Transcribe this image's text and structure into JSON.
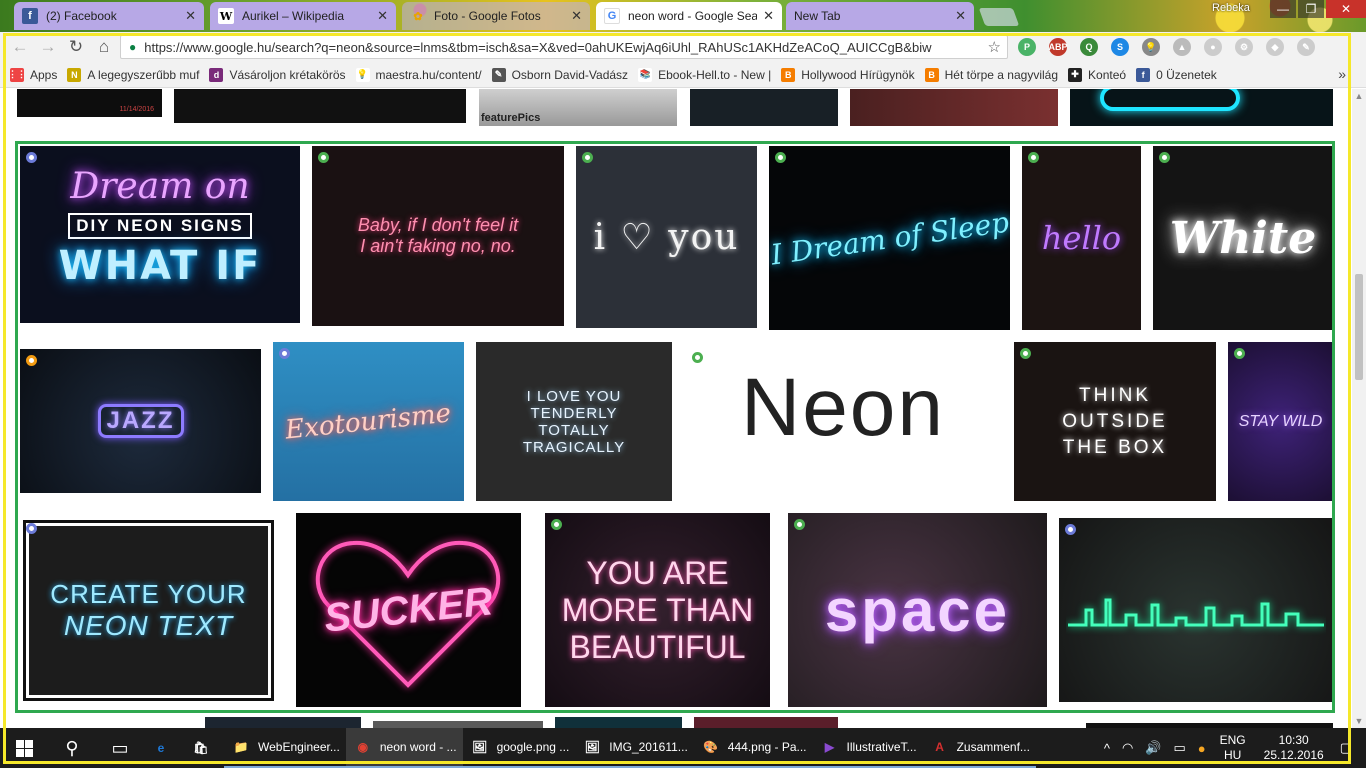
{
  "tabs": [
    {
      "label": "(2) Facebook",
      "fav": "f",
      "favColor": "#3b5998"
    },
    {
      "label": "Aurikel – Wikipedia",
      "fav": "W",
      "favColor": "#fff"
    },
    {
      "label": "Foto - Google Fotos",
      "fav": "✿",
      "favColor": "#e8a400"
    },
    {
      "label": "neon word - Google Sea",
      "fav": "G",
      "favColor": "#fff"
    },
    {
      "label": "New Tab",
      "fav": "",
      "favColor": ""
    }
  ],
  "profile": "Rebeka",
  "window_buttons": {
    "min": "—",
    "max": "❐",
    "close": "✕"
  },
  "toolbar": {
    "back": "←",
    "forward": "→",
    "reload": "↻",
    "home": "⌂",
    "url": "https://www.google.hu/search?q=neon&source=lnms&tbm=isch&sa=X&ved=0ahUKEwjAq6iUhl_RAhUSc1AKHdZeACoQ_AUICCgB&biw",
    "lock": "🔒",
    "star": "☆"
  },
  "extensions": [
    {
      "name": "pushbullet-icon",
      "color": "#4ab367",
      "glyph": "P"
    },
    {
      "name": "adblock-icon",
      "color": "#c0392b",
      "glyph": "ABP"
    },
    {
      "name": "magnifier-ext-icon",
      "color": "#3b8a3b",
      "glyph": "Q"
    },
    {
      "name": "skype-icon",
      "color": "#1e88e5",
      "glyph": "S"
    },
    {
      "name": "lightbulb-icon",
      "color": "#888",
      "glyph": "💡"
    },
    {
      "name": "drive-icon",
      "color": "#bbb",
      "glyph": "▲"
    },
    {
      "name": "extension-gray-icon",
      "color": "#ccc",
      "glyph": "●"
    },
    {
      "name": "gear-ext-icon",
      "color": "#ccc",
      "glyph": "⚙"
    },
    {
      "name": "puzzle-icon",
      "color": "#ccc",
      "glyph": "◆"
    },
    {
      "name": "pin-icon",
      "color": "#ccc",
      "glyph": "✎"
    }
  ],
  "bookmarks": [
    {
      "label": "Apps",
      "icon": "⋮⋮",
      "color": "#e44"
    },
    {
      "label": "A legegyszerűbb muf",
      "icon": "N",
      "color": "#c8a800"
    },
    {
      "label": "Vásároljon krétakörös",
      "icon": "d",
      "color": "#7a2a7a"
    },
    {
      "label": "maestra.hu/content/",
      "icon": "💡",
      "color": "#fff"
    },
    {
      "label": "Osborn David-Vadász",
      "icon": "✎",
      "color": "#555"
    },
    {
      "label": "Ebook-Hell.to - New |",
      "icon": "📚",
      "color": "#fff"
    },
    {
      "label": "Hollywood Hírügynök",
      "icon": "B",
      "color": "#f57d00"
    },
    {
      "label": "Hét törpe a nagyvilág",
      "icon": "B",
      "color": "#f57d00"
    },
    {
      "label": "Konteó",
      "icon": "✚",
      "color": "#222"
    },
    {
      "label": "0 Üzenetek",
      "icon": "f",
      "color": "#3b5998"
    }
  ],
  "bookmarks_more": "»",
  "images": [
    {
      "name": "dream-on-diy-neon-image",
      "lines": [
        "Dream on",
        "DIY NEON SIGNS",
        "WHAT IF"
      ],
      "bg": "#0b0f1e",
      "badge": "blue"
    },
    {
      "name": "baby-neon-image",
      "lines": [
        "Baby, if I don't feel it",
        "I ain't faking no, no."
      ],
      "bg": "#1a1112",
      "badge": "green"
    },
    {
      "name": "i-love-you-neon-image",
      "lines": [
        "i ♡ you"
      ],
      "bg": "#2c3038",
      "badge": "green"
    },
    {
      "name": "i-dream-of-sleep-neon-image",
      "lines": [
        "I Dream of Sleep"
      ],
      "bg": "#050608",
      "badge": "green"
    },
    {
      "name": "hello-neon-image",
      "lines": [
        "hello"
      ],
      "bg": "#1c1412",
      "badge": "green"
    },
    {
      "name": "white-neon-image",
      "lines": [
        "White"
      ],
      "bg": "#141414",
      "badge": "green"
    },
    {
      "name": "jazz-neon-image",
      "lines": [
        "JAZZ"
      ],
      "bg": "#0f1520",
      "badge": "orange"
    },
    {
      "name": "exotourisme-neon-image",
      "lines": [
        "Exotourisme"
      ],
      "bg": "#2d86b8",
      "badge": "blue"
    },
    {
      "name": "i-love-you-tenderly-neon-image",
      "lines": [
        "I LOVE YOU",
        "TENDERLY",
        "TOTALLY",
        "TRAGICALLY"
      ],
      "bg": "#2a2a2a",
      "badge": ""
    },
    {
      "name": "neon-vector-text-image",
      "lines": [
        "Neon"
      ],
      "bg": "#ffffff",
      "badge": "green"
    },
    {
      "name": "think-outside-the-box-neon-image",
      "lines": [
        "THINK",
        "OUTSIDE",
        "THE BOX"
      ],
      "bg": "#1a1412",
      "badge": "green"
    },
    {
      "name": "stay-wild-neon-image",
      "lines": [
        "STAY WILD"
      ],
      "bg": "#241540",
      "badge": "green"
    },
    {
      "name": "create-your-neon-text-image",
      "lines": [
        "CREATE YOUR",
        "NEON TEXT"
      ],
      "bg": "#1c1c1c",
      "badge": "blue"
    },
    {
      "name": "sucker-heart-neon-image",
      "lines": [
        "SUCKER"
      ],
      "bg": "#050505",
      "badge": ""
    },
    {
      "name": "you-are-more-than-beautiful-neon-image",
      "lines": [
        "YOU ARE",
        "MORE THAN",
        "BEAUTIFUL"
      ],
      "bg": "#221420",
      "badge": "green"
    },
    {
      "name": "space-neon-image",
      "lines": [
        "space"
      ],
      "bg": "#2a2424",
      "badge": "green"
    },
    {
      "name": "skyline-neon-image",
      "lines": [],
      "bg": "#1a1a1a",
      "badge": "blue"
    }
  ],
  "partial_top_images": [
    {
      "name": "partial-image-1",
      "caption": "11/14/2016"
    },
    {
      "name": "partial-image-3",
      "caption": "featurePics"
    }
  ],
  "taskbar": {
    "apps": [
      {
        "label": "",
        "icon": "e",
        "color": "#1e78d6",
        "name": "edge-taskbar-icon"
      },
      {
        "label": "",
        "icon": "🛍",
        "color": "#fff",
        "name": "store-taskbar-icon"
      },
      {
        "label": "WebEngineer...",
        "icon": "📁",
        "color": "#e8b83a",
        "name": "explorer-taskbar-app"
      },
      {
        "label": "neon word - ...",
        "icon": "◉",
        "color": "#e34133",
        "name": "chrome-taskbar-app"
      },
      {
        "label": "google.png ...",
        "icon": "🖼",
        "color": "#fff",
        "name": "photo-google-taskbar-app"
      },
      {
        "label": "IMG_201611...",
        "icon": "🖼",
        "color": "#fff",
        "name": "photo-img-taskbar-app"
      },
      {
        "label": "444.png - Pa...",
        "icon": "🎨",
        "color": "#fff",
        "name": "paint-taskbar-app"
      },
      {
        "label": "IllustrativeT...",
        "icon": "▶",
        "color": "#8a4ad0",
        "name": "visual-studio-taskbar-app"
      },
      {
        "label": "Zusammenf...",
        "icon": "A",
        "color": "#d32f2f",
        "name": "acrobat-taskbar-app"
      }
    ],
    "tray_icons": [
      "^",
      "◠",
      "🔊",
      "▭",
      "●"
    ],
    "lang": [
      "ENG",
      "HU"
    ],
    "time": "10:30",
    "date": "25.12.2016",
    "notif": "▢"
  }
}
